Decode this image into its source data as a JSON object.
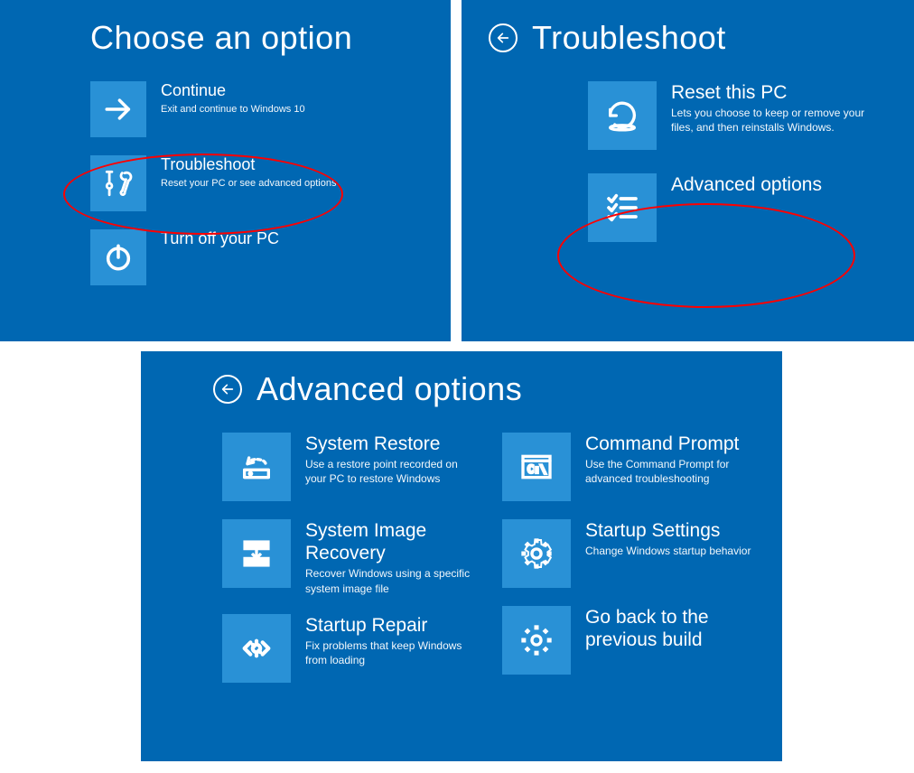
{
  "panel1": {
    "title": "Choose an option",
    "options": [
      {
        "title": "Continue",
        "desc": "Exit and continue to Windows 10",
        "icon": "arrow-right-icon"
      },
      {
        "title": "Troubleshoot",
        "desc": "Reset your PC or see advanced options",
        "icon": "tools-icon"
      },
      {
        "title": "Turn off your PC",
        "desc": "",
        "icon": "power-icon"
      }
    ]
  },
  "panel2": {
    "title": "Troubleshoot",
    "options": [
      {
        "title": "Reset this PC",
        "desc": "Lets you choose to keep or remove your files, and then reinstalls Windows.",
        "icon": "reset-icon"
      },
      {
        "title": "Advanced options",
        "desc": "",
        "icon": "checklist-icon"
      }
    ]
  },
  "panel3": {
    "title": "Advanced options",
    "col1": [
      {
        "title": "System Restore",
        "desc": "Use a restore point recorded on your PC to restore Windows",
        "icon": "restore-icon"
      },
      {
        "title": "System Image Recovery",
        "desc": "Recover Windows using a specific system image file",
        "icon": "image-recovery-icon"
      },
      {
        "title": "Startup Repair",
        "desc": "Fix problems that keep Windows from loading",
        "icon": "repair-icon"
      }
    ],
    "col2": [
      {
        "title": "Command Prompt",
        "desc": "Use the Command Prompt for advanced troubleshooting",
        "icon": "cmd-icon"
      },
      {
        "title": "Startup Settings",
        "desc": "Change Windows startup behavior",
        "icon": "gear-icon"
      },
      {
        "title": "Go back to the previous build",
        "desc": "",
        "icon": "gear-icon"
      }
    ]
  }
}
